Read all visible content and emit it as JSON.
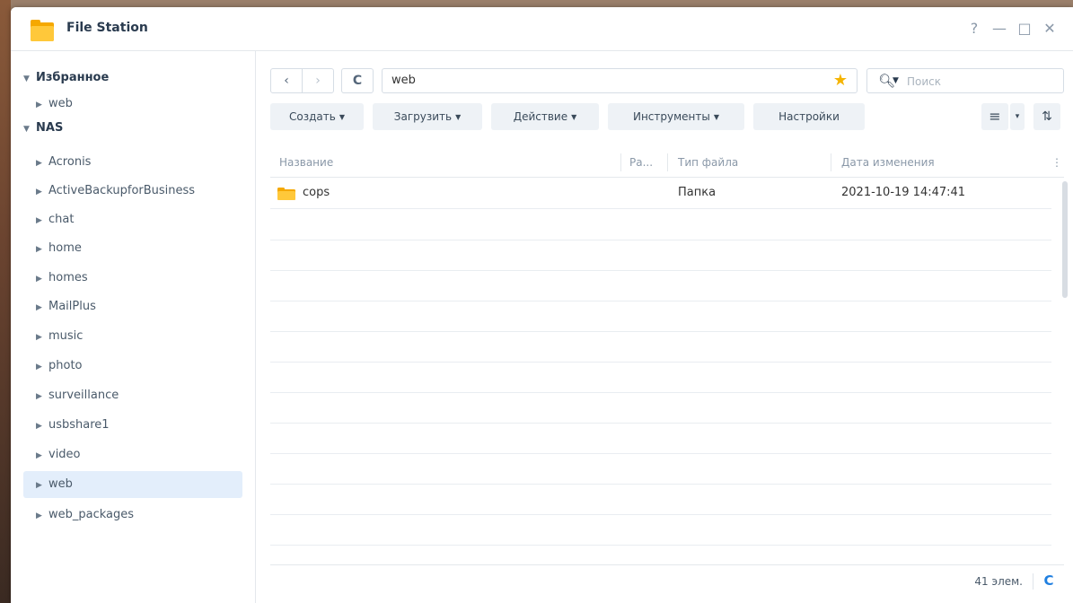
{
  "window": {
    "title": "File Station",
    "controls": {
      "help": "?",
      "minimize": "—",
      "maximize": "□",
      "close": "✕"
    }
  },
  "sidebar": {
    "favorites": {
      "label": "Избранное",
      "items": [
        {
          "label": "web"
        }
      ]
    },
    "nas": {
      "label": "NAS",
      "items": [
        {
          "label": "Acronis"
        },
        {
          "label": "ActiveBackupforBusiness"
        },
        {
          "label": "chat"
        },
        {
          "label": "home"
        },
        {
          "label": "homes"
        },
        {
          "label": "MailPlus"
        },
        {
          "label": "music"
        },
        {
          "label": "photo"
        },
        {
          "label": "surveillance"
        },
        {
          "label": "usbshare1"
        },
        {
          "label": "video"
        },
        {
          "label": "web",
          "selected": true
        },
        {
          "label": "web_packages"
        }
      ]
    }
  },
  "nav": {
    "back": "‹",
    "forward": "›",
    "refresh": "C",
    "path": "web",
    "search_placeholder": "Поиск"
  },
  "toolbar": {
    "create": "Создать",
    "upload": "Загрузить",
    "action": "Действие",
    "tools": "Инструменты",
    "settings": "Настройки",
    "view_list": "≡",
    "view_dropdown": "▾",
    "sort": "⇅"
  },
  "list": {
    "columns": {
      "name": "Название",
      "size": "Ра...",
      "type": "Тип файла",
      "modified": "Дата изменения",
      "more": "⋮"
    },
    "rows": [
      {
        "name": "cops",
        "size": "",
        "type": "Папка",
        "modified": "2021-10-19 14:47:41"
      }
    ]
  },
  "footer": {
    "count": "41 элем.",
    "refresh": "C"
  },
  "colors": {
    "accent": "#1f7fe0",
    "star": "#f5b400",
    "folder": "#f5b400",
    "selected": "#e3eefb"
  }
}
